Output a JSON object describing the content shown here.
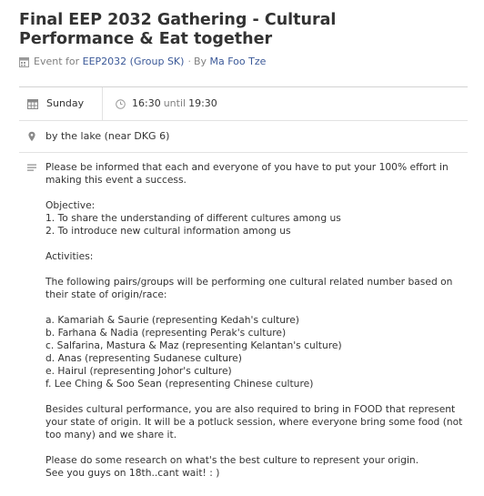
{
  "event": {
    "title": "Final EEP 2032 Gathering - Cultural Performance & Eat together",
    "meta": {
      "prefix": "Event for",
      "group_link": "EEP2032 (Group SK)",
      "separator": "·",
      "by_text": "By",
      "author_link": "Ma Foo Tze"
    },
    "when": {
      "day": "Sunday",
      "start": "16:30",
      "until": "until",
      "end": "19:30"
    },
    "where": {
      "location": "by the lake (near DKG 6)"
    },
    "description": {
      "intro": "Please be informed that each and everyone of you have to put your 100% effort in making this event a success.",
      "objective_heading": "Objective:",
      "objectives": [
        "1. To share the understanding of different cultures among us",
        "2. To introduce new cultural information among us"
      ],
      "activities_heading": "Activities:",
      "activities_intro": "The following pairs/groups will be performing one cultural related number based on their state of origin/race:",
      "performers": [
        "a. Kamariah & Saurie (representing Kedah's culture)",
        "b. Farhana & Nadia (representing Perak's culture)",
        "c. Salfarina, Mastura & Maz (representing Kelantan's culture)",
        "d. Anas (representing Sudanese culture)",
        "e. Hairul (representing Johor's culture)",
        "f. Lee Ching & Soo Sean (representing Chinese culture)"
      ],
      "food_note": "Besides cultural performance, you are also required to bring in FOOD that represent your state of origin. It will be a potluck session, where everyone bring some food (not too many) and we share it.",
      "closing": [
        "Please do some research on what's the best culture to represent your origin.",
        "See you guys on 18th..cant wait! : )"
      ]
    }
  },
  "colors": {
    "link": "#3b5998",
    "text": "#333333",
    "muted": "#808080",
    "divider": "#e2e2e2",
    "icon": "#8a8a8a"
  },
  "icons": {
    "meta": "calendar-small-icon",
    "when": "calendar-icon",
    "time": "clock-icon",
    "where": "map-pin-icon",
    "description": "lines-icon"
  }
}
